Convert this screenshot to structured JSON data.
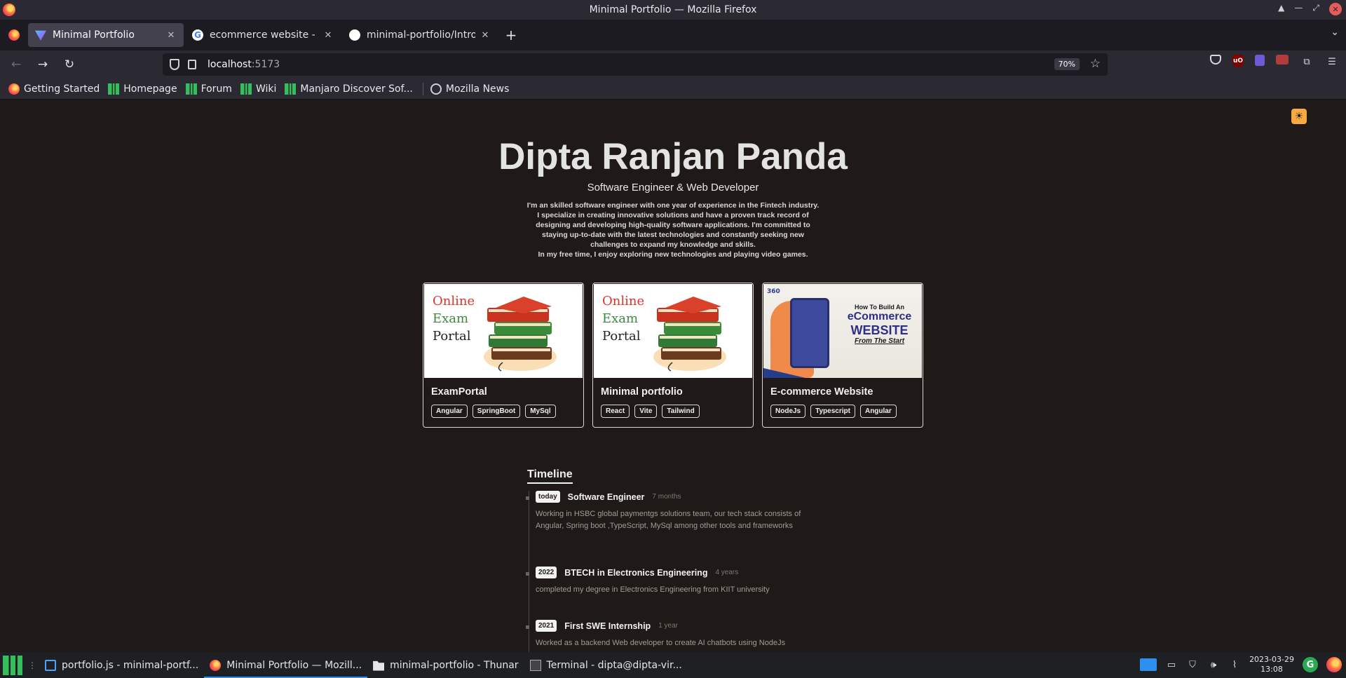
{
  "window": {
    "title": "Minimal Portfolio — Mozilla Firefox"
  },
  "tabs": [
    {
      "label": "Minimal Portfolio",
      "favicon": "vite-icon",
      "active": true
    },
    {
      "label": "ecommerce website - Goo",
      "favicon": "google-icon",
      "active": false
    },
    {
      "label": "minimal-portfolio/Intro.jsx",
      "favicon": "github-icon",
      "active": false
    }
  ],
  "nav": {
    "url_host": "localhost",
    "url_port": ":5173",
    "zoom": "70%"
  },
  "bookmarks": [
    {
      "label": "Getting Started",
      "icon": "firefox-icon"
    },
    {
      "label": "Homepage",
      "icon": "manjaro-icon"
    },
    {
      "label": "Forum",
      "icon": "manjaro-icon"
    },
    {
      "label": "Wiki",
      "icon": "manjaro-icon"
    },
    {
      "label": "Manjaro Discover Sof...",
      "icon": "manjaro-icon"
    },
    {
      "label": "Mozilla News",
      "icon": "globe-icon"
    }
  ],
  "page": {
    "name": "Dipta Ranjan Panda",
    "subtitle": "Software Engineer & Web Developer",
    "bio": [
      "I'm an skilled software engineer with one year of experience in the Fintech industry.",
      "I specialize in creating innovative solutions and have a proven track record of",
      "designing and developing high-quality software applications. I'm committed to",
      "staying up-to-date with the latest technologies and constantly seeking new",
      "challenges to expand my knowledge and skills.",
      "In my free time, I enjoy exploring new technologies and playing video games."
    ],
    "projects": [
      {
        "title": "ExamPortal",
        "thumb_lines": [
          "Online",
          "Exam",
          "Portal"
        ],
        "tags": [
          "Angular",
          "SpringBoot",
          "MySql"
        ]
      },
      {
        "title": "Minimal portfolio",
        "thumb_lines": [
          "Online",
          "Exam",
          "Portal"
        ],
        "tags": [
          "React",
          "Vite",
          "Tailwind"
        ]
      },
      {
        "title": "E-commerce Website",
        "thumb_badge": "360",
        "thumb_lines": [
          "How To Build An",
          "eCommerce",
          "WEBSITE",
          "From The Start"
        ],
        "tags": [
          "NodeJs",
          "Typescript",
          "Angular"
        ]
      }
    ],
    "timeline_title": "Timeline",
    "timeline": [
      {
        "year": "today",
        "role": "Software Engineer",
        "duration": "7 months",
        "desc": "Working in HSBC global paymentgs solutions team, our tech stack consists of Angular, Spring boot ,TypeScript, MySql among other tools and frameworks"
      },
      {
        "year": "2022",
        "role": "BTECH in Electronics Engineering",
        "duration": "4 years",
        "desc": "completed my degree in Electronics Engineering from KIIT university"
      },
      {
        "year": "2021",
        "role": "First SWE Internship",
        "duration": "1 year",
        "desc": "Worked as a backend Web developer to create AI chatbots using NodeJs"
      }
    ]
  },
  "taskbar": {
    "tasks": [
      {
        "label": "portfolio.js - minimal-portf...",
        "icon": "editor-icon",
        "active": false
      },
      {
        "label": "Minimal Portfolio — Mozill...",
        "icon": "firefox-icon",
        "active": true
      },
      {
        "label": "minimal-portfolio - Thunar",
        "icon": "folder-icon",
        "active": false
      },
      {
        "label": "Terminal - dipta@dipta-vir...",
        "icon": "terminal-icon",
        "active": false
      }
    ],
    "date": "2023-03-29",
    "time": "13:08"
  },
  "colors": {
    "accent": "#f7a942",
    "page_bg": "#1f1a17",
    "chrome_bg": "#2b2a33"
  }
}
